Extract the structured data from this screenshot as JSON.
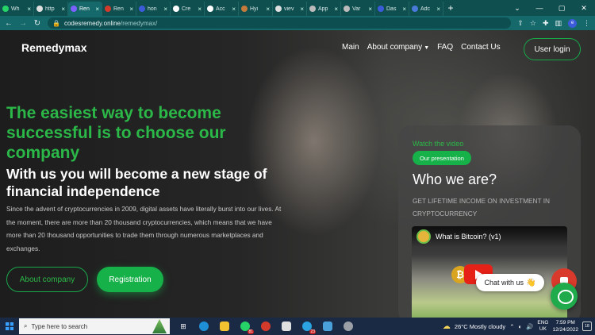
{
  "browser": {
    "tabs": [
      {
        "label": "Wh",
        "color": "#25d366"
      },
      {
        "label": "http",
        "color": "#e0e0e0"
      },
      {
        "label": "Ren",
        "color": "#7b61ff",
        "active": true
      },
      {
        "label": "Ren",
        "color": "#d33a2b"
      },
      {
        "label": "hon",
        "color": "#3b5bd9"
      },
      {
        "label": "Cre",
        "color": "#ffffff"
      },
      {
        "label": "Acc",
        "color": "#ffffff"
      },
      {
        "label": "Hyi",
        "color": "#c47a3a"
      },
      {
        "label": "viev",
        "color": "#e0e0e0"
      },
      {
        "label": "App",
        "color": "#bbbbbb"
      },
      {
        "label": "Var",
        "color": "#bbbbbb"
      },
      {
        "label": "Das",
        "color": "#3b5bd9"
      },
      {
        "label": "Adc",
        "color": "#4a7ad9"
      }
    ],
    "new_tab": "+",
    "url_host": "codesremedy.online",
    "url_path": "/remedymax/",
    "profile_letter": "e"
  },
  "site": {
    "brand": "Remedymax",
    "nav": [
      "Main",
      "About company",
      "FAQ",
      "Contact Us"
    ],
    "login_label": "User login",
    "headline": "The easiest way to become successful is to choose our company",
    "subheadline": "With us you will become a new stage of financial independence",
    "paragraph": "Since the advent of cryptocurrencies in 2009, digital assets have literally burst into our lives. At the moment, there are more than 20 thousand cryptocurrencies, which means that we have more than 20 thousand opportunities to trade them through numerous marketplaces and exchanges.",
    "btn_about": "About company",
    "btn_register": "Registration",
    "card": {
      "watch": "Watch the video",
      "pill": "Our presentation",
      "title": "Who we are?",
      "subtitle": "GET LIFETIME INCOME ON INVESTMENT IN CRYPTOCURRENCY",
      "video_title": "What is Bitcoin? (v1)",
      "coin_symbol": "₿"
    },
    "chat_label": "Chat with us",
    "chat_emoji": "👋"
  },
  "taskbar": {
    "search_placeholder": "Type here to search",
    "badge_1": "81",
    "badge_2": "23",
    "weather": "26°C  Mostly cloudy",
    "lang_1": "ENG",
    "lang_2": "UK",
    "time": "7:59 PM",
    "date": "12/24/2022",
    "notif_count": "18"
  },
  "colors": {
    "accent": "#17b14a",
    "tab_bar": "#0f4f4f",
    "taskbar": "#1a2a44"
  }
}
